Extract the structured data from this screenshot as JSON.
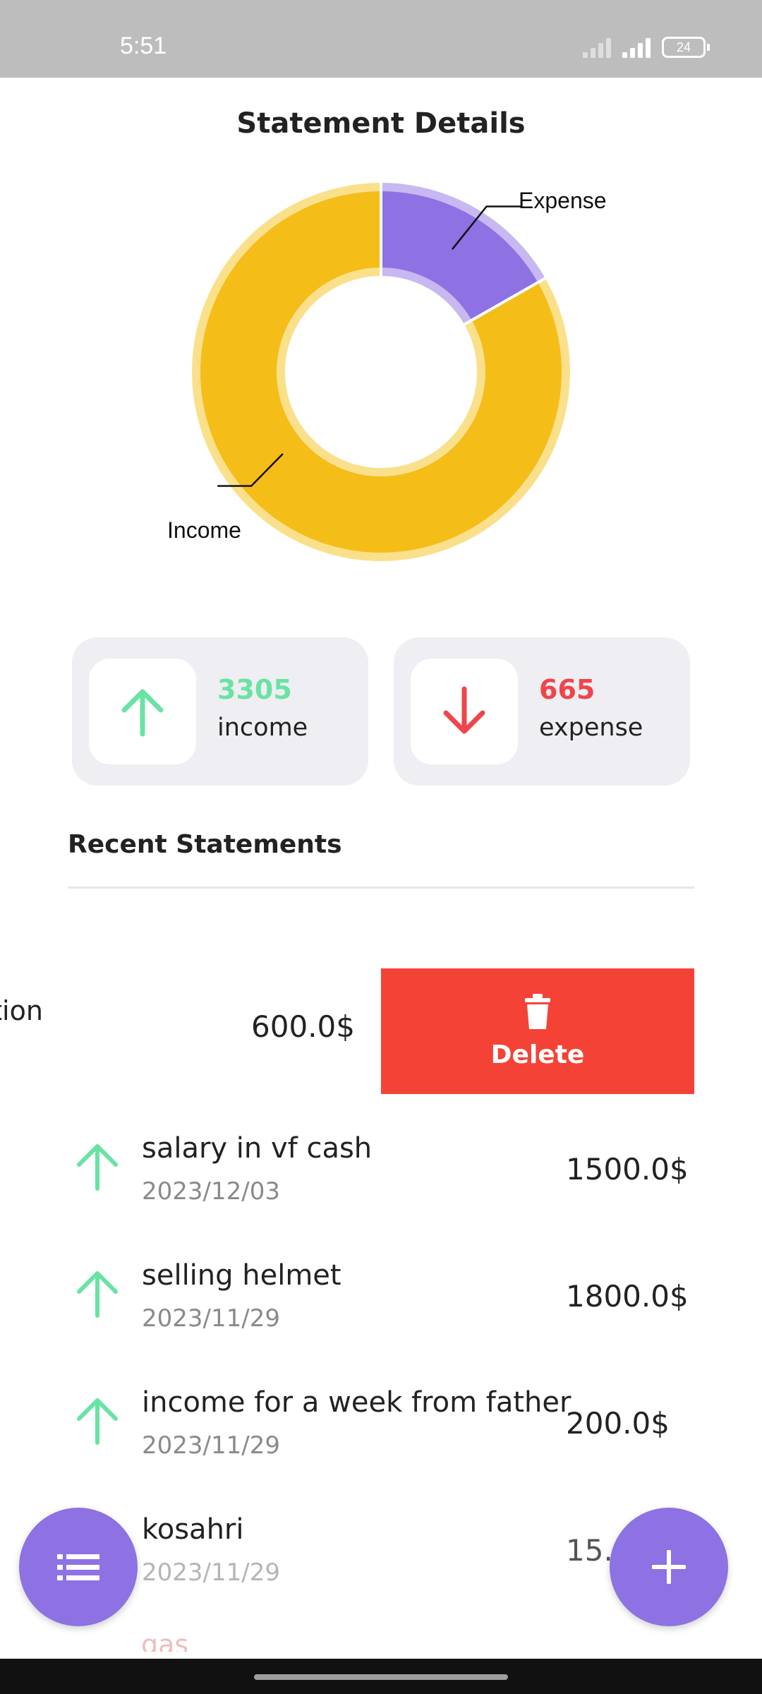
{
  "status_bar": {
    "time": "5:51",
    "battery": "24"
  },
  "page": {
    "title": "Statement Details"
  },
  "chart_data": {
    "type": "pie",
    "style": "donut",
    "slices": [
      {
        "label": "Income",
        "value": 3305,
        "color": "#f5bd18"
      },
      {
        "label": "Expense",
        "value": 665,
        "color": "#8e71e3"
      }
    ],
    "title": "",
    "legend": "callout labels outside slices"
  },
  "summary": {
    "income": {
      "value": "3305",
      "label": "income",
      "color": "#69e3a3"
    },
    "expense": {
      "value": "665",
      "label": "expense",
      "color": "#f0454a"
    }
  },
  "recent": {
    "title": "Recent Statements",
    "swiped": {
      "description": "ption",
      "amount": "600.0$",
      "delete_label": "Delete"
    },
    "items": [
      {
        "description": "salary in vf cash",
        "date": "2023/12/03",
        "amount": "1500.0$",
        "type": "income"
      },
      {
        "description": "selling helmet",
        "date": "2023/11/29",
        "amount": "1800.0$",
        "type": "income"
      },
      {
        "description": "income for a week from father",
        "date": "2023/11/29",
        "amount": "200.0$",
        "type": "income"
      },
      {
        "description": "kosahri",
        "date": "2023/11/29",
        "amount": "15.0$",
        "type": "expense"
      }
    ],
    "partial_next": "gas"
  },
  "fabs": {
    "list_icon": "list-icon",
    "add_icon": "plus-icon",
    "color": "#8e71e3"
  },
  "colors": {
    "income": "#69e3a3",
    "expense": "#f0454a",
    "accent": "#8e71e3",
    "delete": "#f44336"
  }
}
